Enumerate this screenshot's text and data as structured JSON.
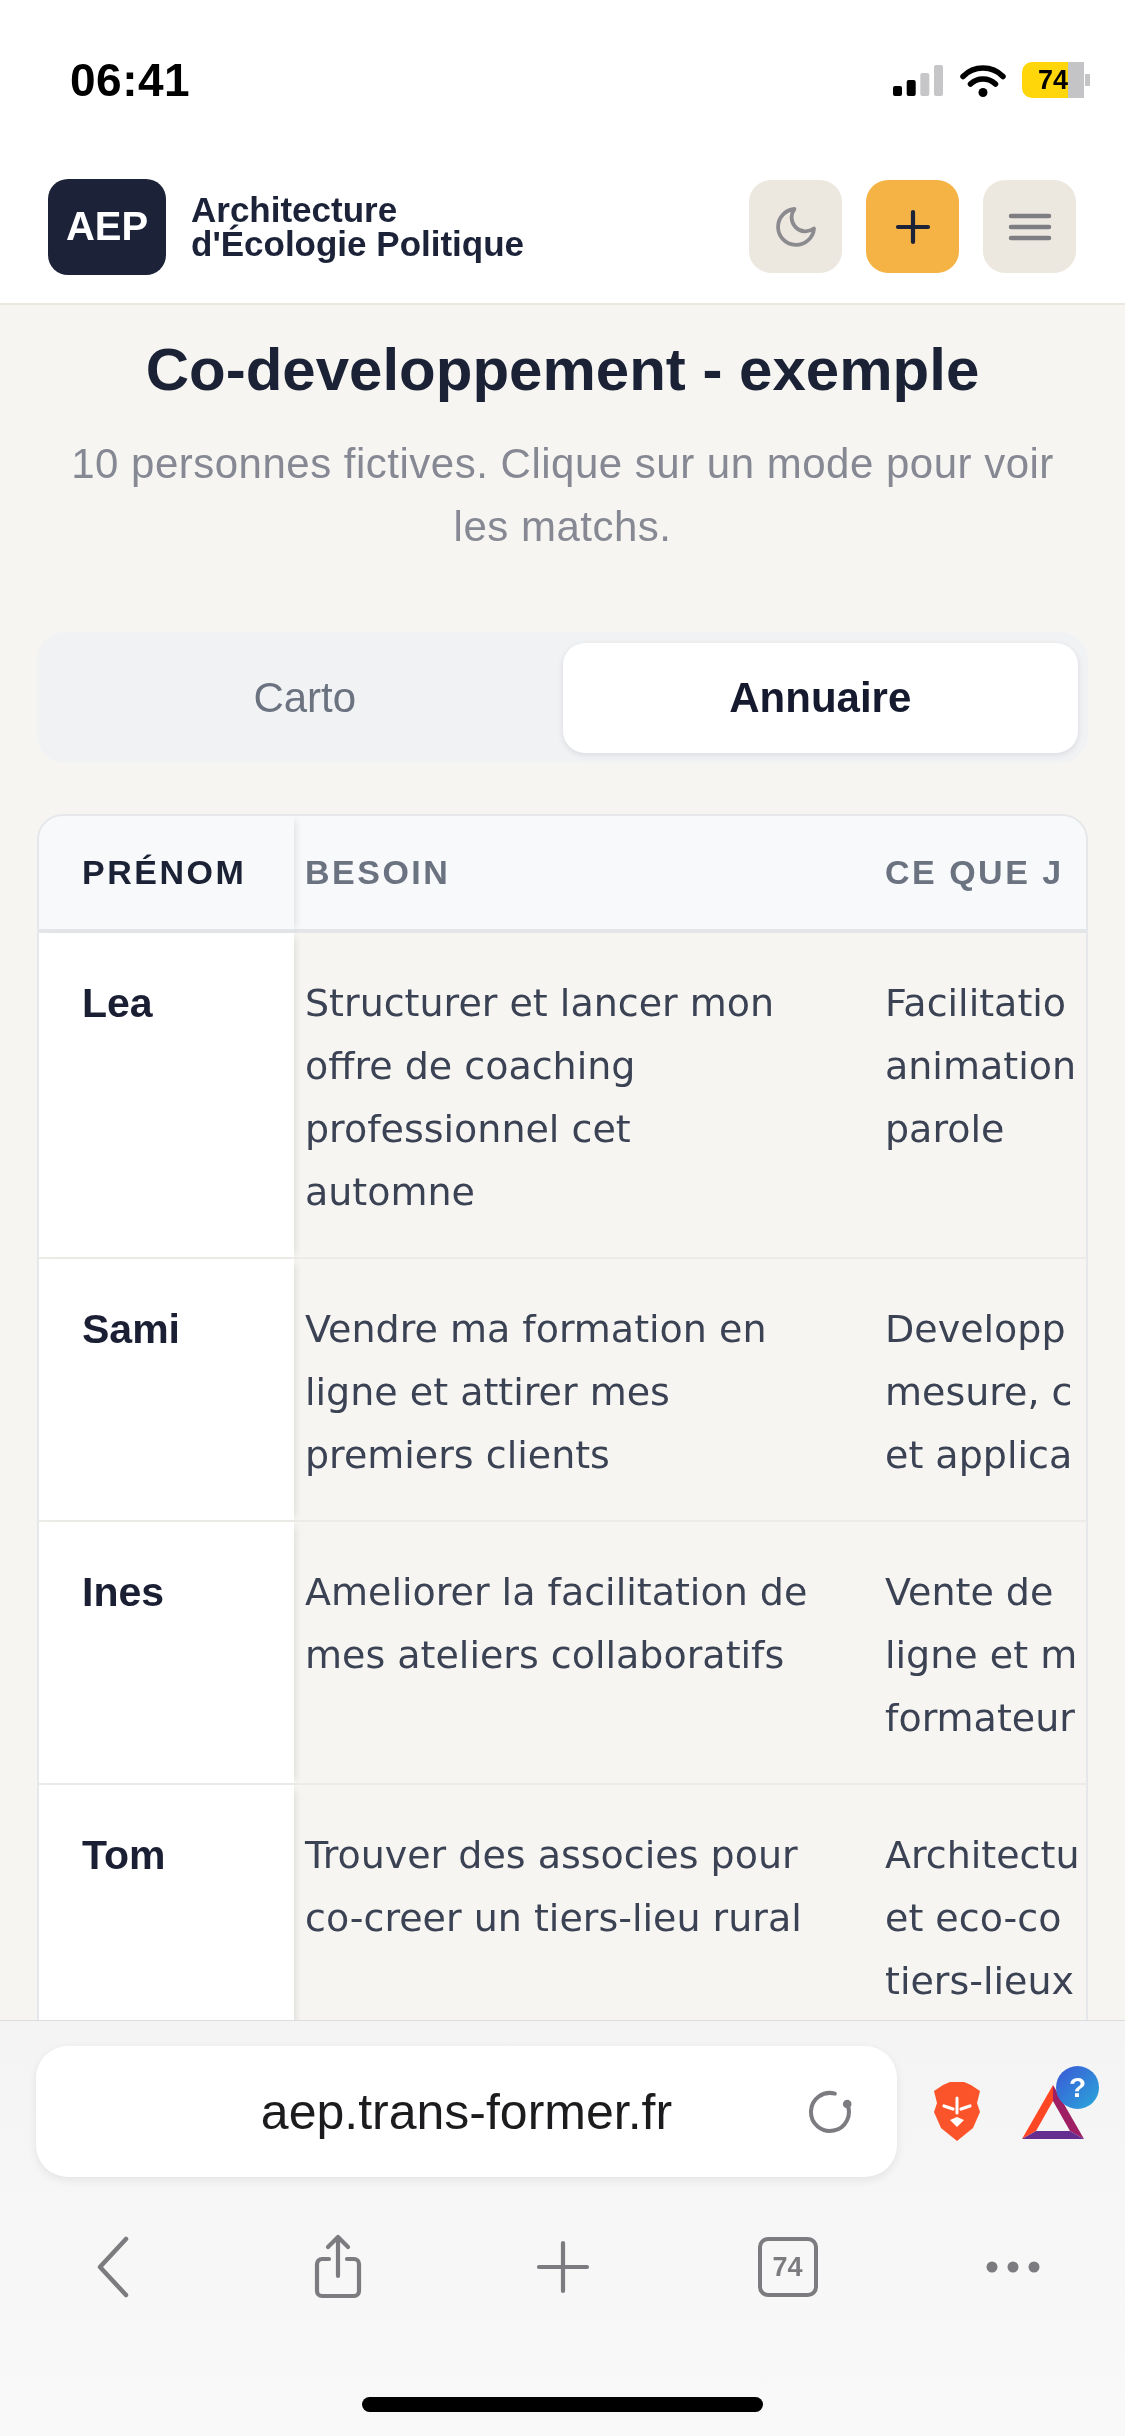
{
  "status_bar": {
    "time": "06:41",
    "battery": "74"
  },
  "header": {
    "logo": "AEP",
    "site_name": "Architecture d'Écologie Politique",
    "buttons": [
      {
        "kind": "theme"
      },
      {
        "kind": "add"
      },
      {
        "kind": "menu"
      }
    ]
  },
  "intro": {
    "title": "Co-developpement - exemple",
    "subtitle": "10 personnes fictives. Clique sur un mode pour voir les matchs."
  },
  "tabs": [
    {
      "label": "Carto",
      "selected": false
    },
    {
      "label": "Annuaire",
      "selected": true
    }
  ],
  "table": {
    "columns": [
      "PRÉNOM",
      "BESOIN",
      "CE QUE J"
    ],
    "rows": [
      {
        "prenom": "Lea",
        "besoin": "Structurer et lancer mon offre de coaching professionnel cet automne",
        "column_3": [
          "Facilitatio",
          "animation",
          "parole"
        ]
      },
      {
        "prenom": "Sami",
        "besoin": "Vendre ma formation en ligne et attirer mes premiers clients",
        "column_3": [
          "Developp",
          "mesure, c",
          "et applica"
        ]
      },
      {
        "prenom": "Ines",
        "besoin": "Ameliorer la facilitation de mes ateliers collaboratifs",
        "column_3": [
          "Vente de",
          "ligne et m",
          "formateur"
        ]
      },
      {
        "prenom": "Tom",
        "besoin": "Trouver des associes pour co-creer un tiers-lieu rural",
        "column_3": [
          "Architectu",
          "et eco-co",
          "tiers-lieux"
        ]
      }
    ]
  },
  "browser": {
    "url": "aep.trans-former.fr",
    "extensions": [
      {
        "kind": "shield"
      },
      {
        "kind": "triangle",
        "badge": "?"
      }
    ],
    "toolbar": [
      {
        "kind": "back"
      },
      {
        "kind": "share"
      },
      {
        "kind": "new-tab"
      },
      {
        "kind": "tabs",
        "count": "74"
      },
      {
        "kind": "more"
      }
    ]
  }
}
